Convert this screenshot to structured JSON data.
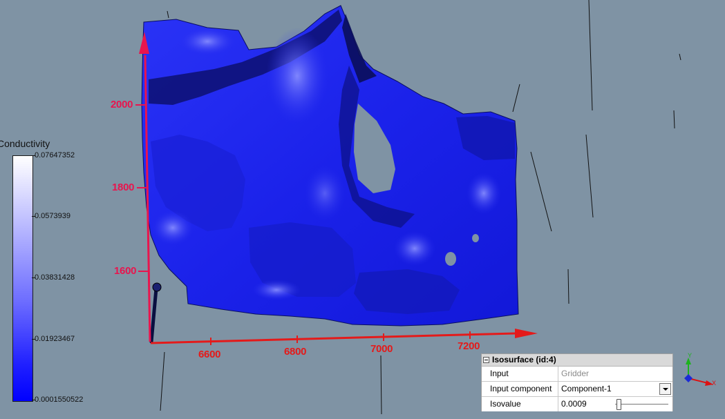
{
  "colorbar": {
    "title": "Conductivity",
    "labels": [
      "0.07647352",
      "0.0573939",
      "0.03831428",
      "0.01923467",
      "0.0001550522"
    ]
  },
  "axes": {
    "x_ticks": [
      "6600",
      "6800",
      "7000",
      "7200"
    ],
    "y_ticks": [
      "2000",
      "1800",
      "1600"
    ],
    "x_color": "#e41a1a",
    "y_color": "#e8154e"
  },
  "orientation_widget": {
    "y_label": "Y",
    "x_label": "X"
  },
  "panel": {
    "title": "Isosurface (id:4)",
    "rows": [
      {
        "name": "Input",
        "value": "Gridder"
      },
      {
        "name": "Input component",
        "value": "Component-1"
      },
      {
        "name": "Isovalue",
        "value": "0.0009"
      }
    ]
  },
  "colors": {
    "background": "#7f93a4",
    "surface": "#1f27ee",
    "surface_dark": "#0a0f60"
  }
}
